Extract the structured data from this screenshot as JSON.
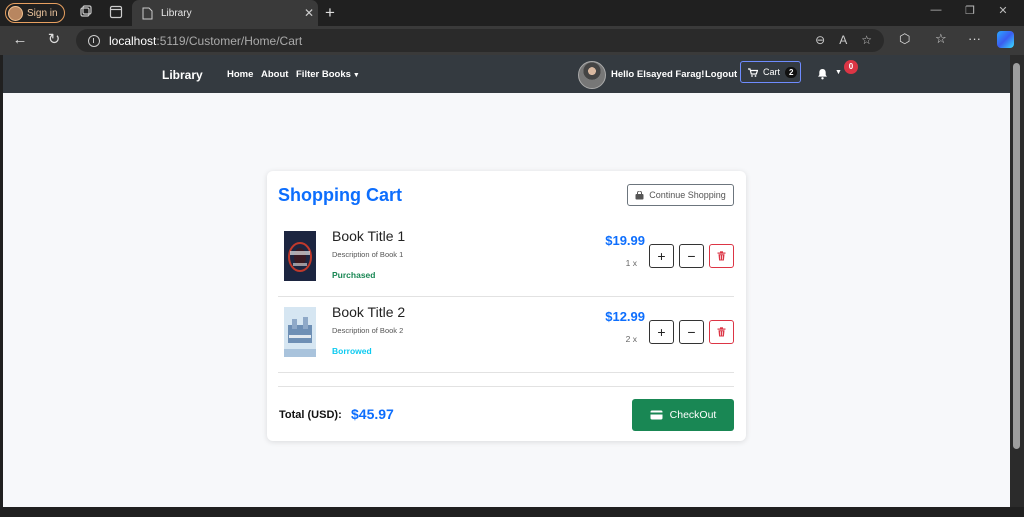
{
  "browser": {
    "signin_label": "Sign in",
    "tab_title": "Library",
    "url_host": "localhost",
    "url_path": ":5119/Customer/Home/Cart"
  },
  "navbar": {
    "brand": "Library",
    "links": [
      "Home",
      "About",
      "Filter Books"
    ],
    "greeting": "Hello Elsayed Farag!",
    "logout": "Logout",
    "cart_label": "Cart",
    "cart_count": "2",
    "notification_count": "0"
  },
  "cart": {
    "title": "Shopping Cart",
    "continue_label": "Continue Shopping",
    "items": [
      {
        "title": "Book Title 1",
        "description": "Description of Book 1",
        "status": "Purchased",
        "status_color": "#198754",
        "price": "$19.99",
        "quantity": "1 x"
      },
      {
        "title": "Book Title 2",
        "description": "Description of Book 2",
        "status": "Borrowed",
        "status_color": "#0dcaf0",
        "price": "$12.99",
        "quantity": "2 x"
      }
    ],
    "total_label": "Total (USD):",
    "total_value": "$45.97",
    "checkout_label": "CheckOut"
  },
  "colors": {
    "accent": "#0d6efd",
    "success": "#198754",
    "danger": "#dc3545",
    "navbar": "#343a40"
  }
}
